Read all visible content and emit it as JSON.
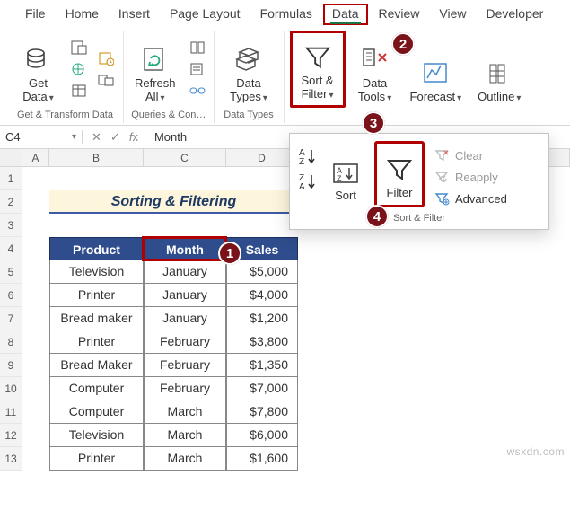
{
  "tabs": {
    "file": "File",
    "home": "Home",
    "insert": "Insert",
    "page_layout": "Page Layout",
    "formulas": "Formulas",
    "data": "Data",
    "review": "Review",
    "view": "View",
    "developer": "Developer"
  },
  "ribbon": {
    "get_data": "Get\nData",
    "refresh": "Refresh\nAll",
    "data_types": "Data\nTypes",
    "sort_filter": "Sort &\nFilter",
    "data_tools": "Data\nTools",
    "forecast": "Forecast",
    "outline": "Outline",
    "group_get": "Get & Transform Data",
    "group_qc": "Queries & Con…",
    "group_types": "Data Types"
  },
  "fx": {
    "namebox": "C4",
    "value": "Month"
  },
  "cols": {
    "A": "A",
    "B": "B",
    "C": "C",
    "D": "D"
  },
  "rows": [
    "1",
    "2",
    "3",
    "4",
    "5",
    "6",
    "7",
    "8",
    "9",
    "10",
    "11",
    "12",
    "13"
  ],
  "title": "Sorting & Filtering",
  "headers": {
    "product": "Product",
    "month": "Month",
    "sales": "Sales"
  },
  "data": [
    {
      "p": "Television",
      "m": "January",
      "s": "$5,000"
    },
    {
      "p": "Printer",
      "m": "January",
      "s": "$4,000"
    },
    {
      "p": "Bread maker",
      "m": "January",
      "s": "$1,200"
    },
    {
      "p": "Printer",
      "m": "February",
      "s": "$3,800"
    },
    {
      "p": "Bread Maker",
      "m": "February",
      "s": "$1,350"
    },
    {
      "p": "Computer",
      "m": "February",
      "s": "$7,000"
    },
    {
      "p": "Computer",
      "m": "March",
      "s": "$7,800"
    },
    {
      "p": "Television",
      "m": "March",
      "s": "$6,000"
    },
    {
      "p": "Printer",
      "m": "March",
      "s": "$1,600"
    }
  ],
  "dropdown": {
    "sort": "Sort",
    "filter": "Filter",
    "clear": "Clear",
    "reapply": "Reapply",
    "advanced": "Advanced",
    "group": "Sort & Filter"
  },
  "badges": {
    "b1": "1",
    "b2": "2",
    "b3": "3",
    "b4": "4"
  },
  "watermark": "wsxdn.com"
}
